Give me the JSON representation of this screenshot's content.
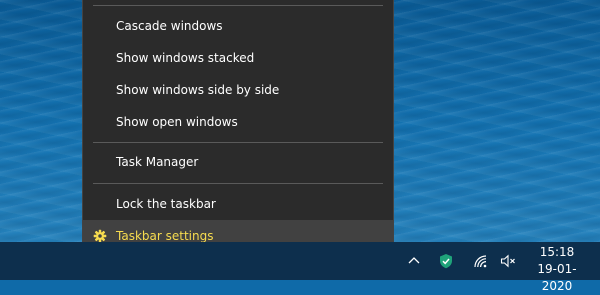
{
  "menu": {
    "items": [
      {
        "label": "Cascade windows"
      },
      {
        "label": "Show windows stacked"
      },
      {
        "label": "Show windows side by side"
      },
      {
        "label": "Show open windows"
      },
      {
        "label": "Task Manager"
      },
      {
        "label": "Lock the taskbar"
      },
      {
        "label": "Taskbar settings",
        "icon": "gear-icon",
        "highlighted": true
      }
    ]
  },
  "tray": {
    "icons": [
      "chevron-up-icon",
      "shield-check-icon",
      "wifi-icon",
      "speaker-muted-icon"
    ],
    "time": "15:18",
    "date": "19-01-2020"
  },
  "colors": {
    "menu_bg": "#2b2b2b",
    "highlight_bg": "#414141",
    "highlight_text": "#f7dc4f",
    "taskbar_bg": "#0d2f4d",
    "shield": "#1fa37a"
  }
}
